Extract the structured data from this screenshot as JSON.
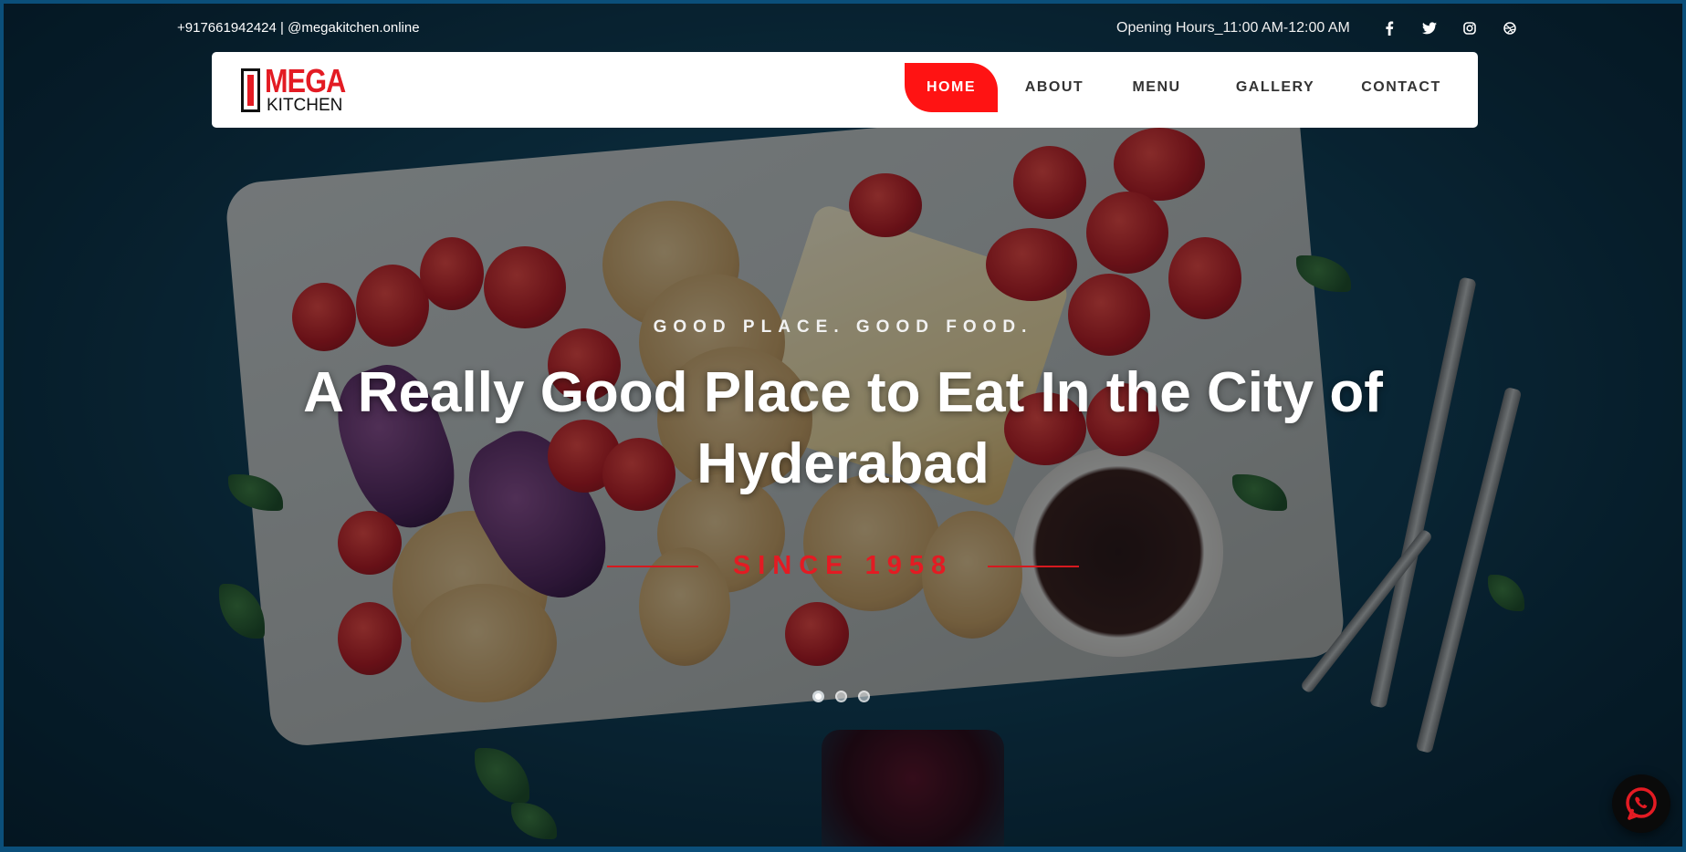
{
  "topbar": {
    "contact": "+917661942424 | @megakitchen.online",
    "hours": "Opening Hours_11:00 AM-12:00 AM",
    "social": [
      "facebook-icon",
      "twitter-icon",
      "instagram-icon",
      "dribbble-icon"
    ]
  },
  "brand": {
    "logo_top": "MEGA",
    "logo_bottom": "KITCHEN",
    "accent_color": "#ff1313"
  },
  "nav": {
    "items": [
      {
        "label": "HOME",
        "active": true
      },
      {
        "label": "ABOUT",
        "active": false
      },
      {
        "label": "MENU",
        "active": false
      },
      {
        "label": "GALLERY",
        "active": false
      },
      {
        "label": "CONTACT",
        "active": false
      }
    ]
  },
  "hero": {
    "eyebrow": "GOOD PLACE. GOOD FOOD.",
    "headline": "A Really Good Place to Eat In the City of Hyderabad",
    "since": "SINCE 1958",
    "slides": 3,
    "active_slide": 1
  },
  "floating": {
    "whatsapp_icon": "whatsapp-icon"
  }
}
